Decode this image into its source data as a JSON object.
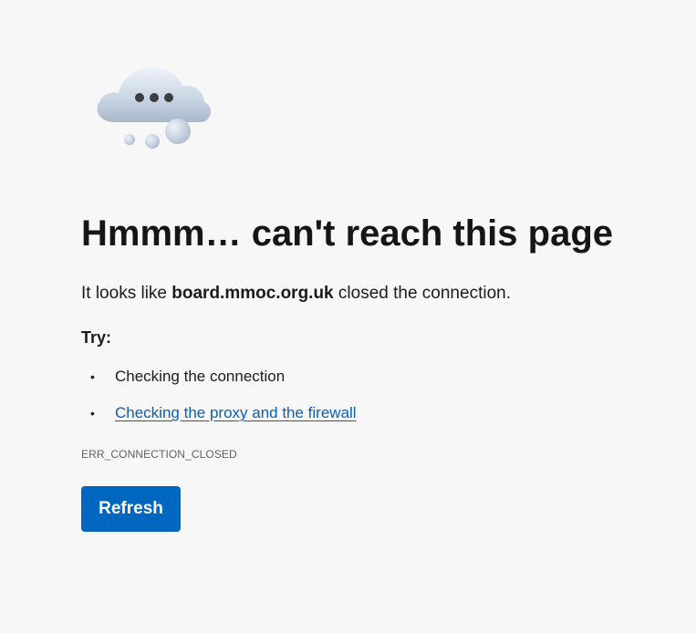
{
  "illustration": {
    "icon": "cloud-thinking-icon",
    "color": "#c9d5e4"
  },
  "error": {
    "title": "Hmmm… can't reach this page",
    "message_prefix": "It looks like",
    "host": "board.mmoc.org.uk",
    "message_suffix": "closed the connection.",
    "try_label": "Try:",
    "suggestions": [
      {
        "label": "Checking the connection",
        "is_link": false
      },
      {
        "label": "Checking the proxy and the firewall",
        "is_link": true
      }
    ],
    "code": "ERR_CONNECTION_CLOSED"
  },
  "actions": {
    "refresh_label": "Refresh",
    "refresh_color": "#0067c0"
  }
}
